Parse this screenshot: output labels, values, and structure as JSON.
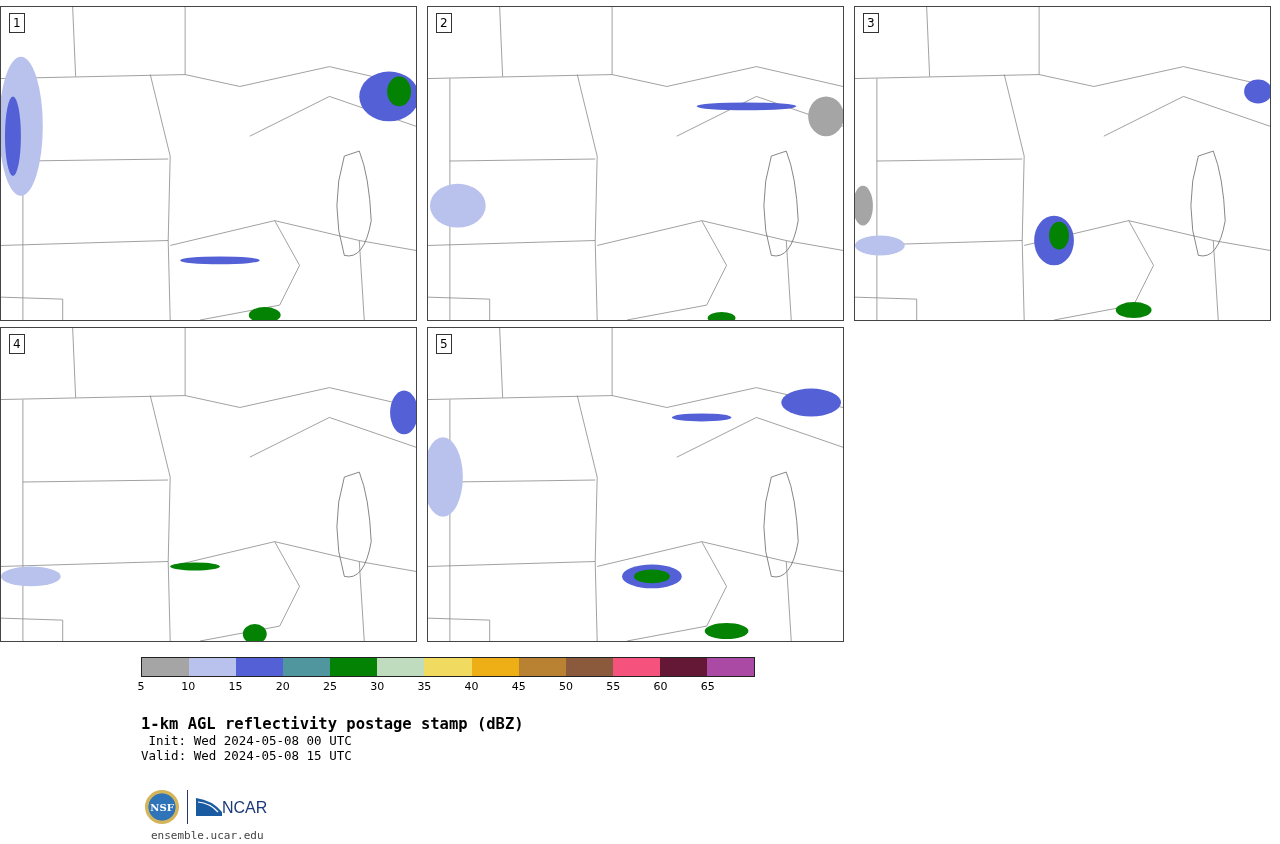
{
  "panels": [
    {
      "label": "1"
    },
    {
      "label": "2"
    },
    {
      "label": "3"
    },
    {
      "label": "4"
    },
    {
      "label": "5"
    }
  ],
  "colorbar": {
    "bins": [
      {
        "color": "#a5a5a5"
      },
      {
        "color": "#b8c2ec"
      },
      {
        "color": "#5360d6"
      },
      {
        "color": "#4f969e"
      },
      {
        "color": "#038203"
      },
      {
        "color": "#bfdcbf"
      },
      {
        "color": "#f0da5f"
      },
      {
        "color": "#eeaf16"
      },
      {
        "color": "#b98232"
      },
      {
        "color": "#8b593c"
      },
      {
        "color": "#f5527e"
      },
      {
        "color": "#641836"
      },
      {
        "color": "#ab4aa4"
      }
    ],
    "ticks": [
      "5",
      "10",
      "15",
      "20",
      "25",
      "30",
      "35",
      "40",
      "45",
      "50",
      "55",
      "60",
      "65"
    ]
  },
  "title": "1-km AGL reflectivity postage stamp (dBZ)",
  "times": [
    {
      "label": "Init:",
      "value": "Wed 2024-05-08 00 UTC"
    },
    {
      "label": "Valid:",
      "value": "Wed 2024-05-08 15 UTC"
    }
  ],
  "logos": {
    "seal": "NSF",
    "org": "NCAR"
  },
  "url": "ensemble.ucar.edu"
}
